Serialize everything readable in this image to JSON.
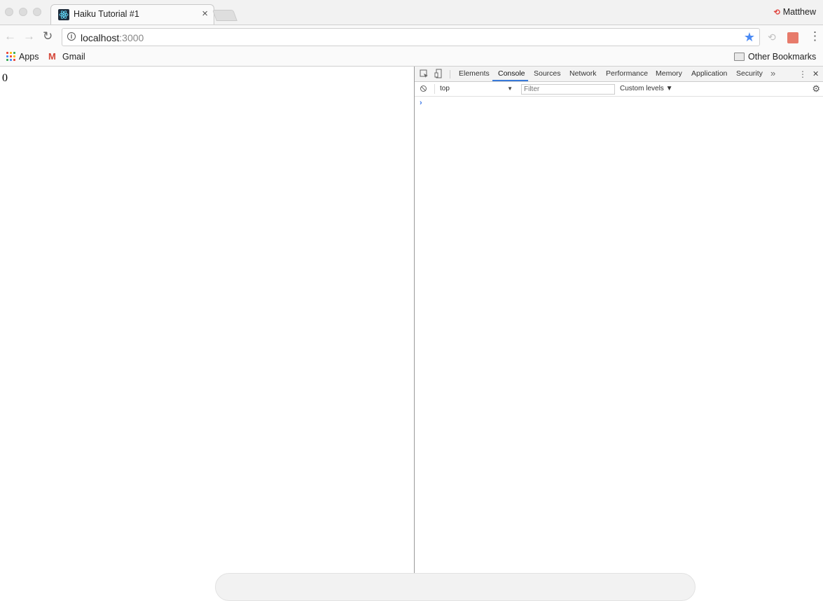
{
  "tab": {
    "title": "Haiku Tutorial #1",
    "close": "×"
  },
  "profile": {
    "name": "Matthew",
    "icon": "profile-icon"
  },
  "toolbar": {
    "back": "←",
    "forward": "→",
    "reload": "↻",
    "url_host": "localhost",
    "url_port": ":3000",
    "bookmark_star": "★",
    "extension_sync": "⟲",
    "menu": "⋮"
  },
  "bookmarks": {
    "apps_label": "Apps",
    "gmail_label": "Gmail",
    "other_label": "Other Bookmarks"
  },
  "page": {
    "content": "0"
  },
  "devtools": {
    "tabs": [
      {
        "label": "Elements"
      },
      {
        "label": "Console"
      },
      {
        "label": "Sources"
      },
      {
        "label": "Network"
      },
      {
        "label": "Performance"
      },
      {
        "label": "Memory"
      },
      {
        "label": "Application"
      },
      {
        "label": "Security"
      }
    ],
    "more_tabs": "»",
    "kebab": "⋮",
    "close": "✕",
    "context": "top",
    "context_arrow": "▼",
    "filter_placeholder": "Filter",
    "levels": "Custom levels ▼",
    "settings": "⚙",
    "prompt": "›"
  },
  "colors": {
    "accent": "#4a8af4",
    "devtools_active": "#3879d9",
    "profile_red": "#e0443e",
    "gmail_red": "#d44638"
  }
}
